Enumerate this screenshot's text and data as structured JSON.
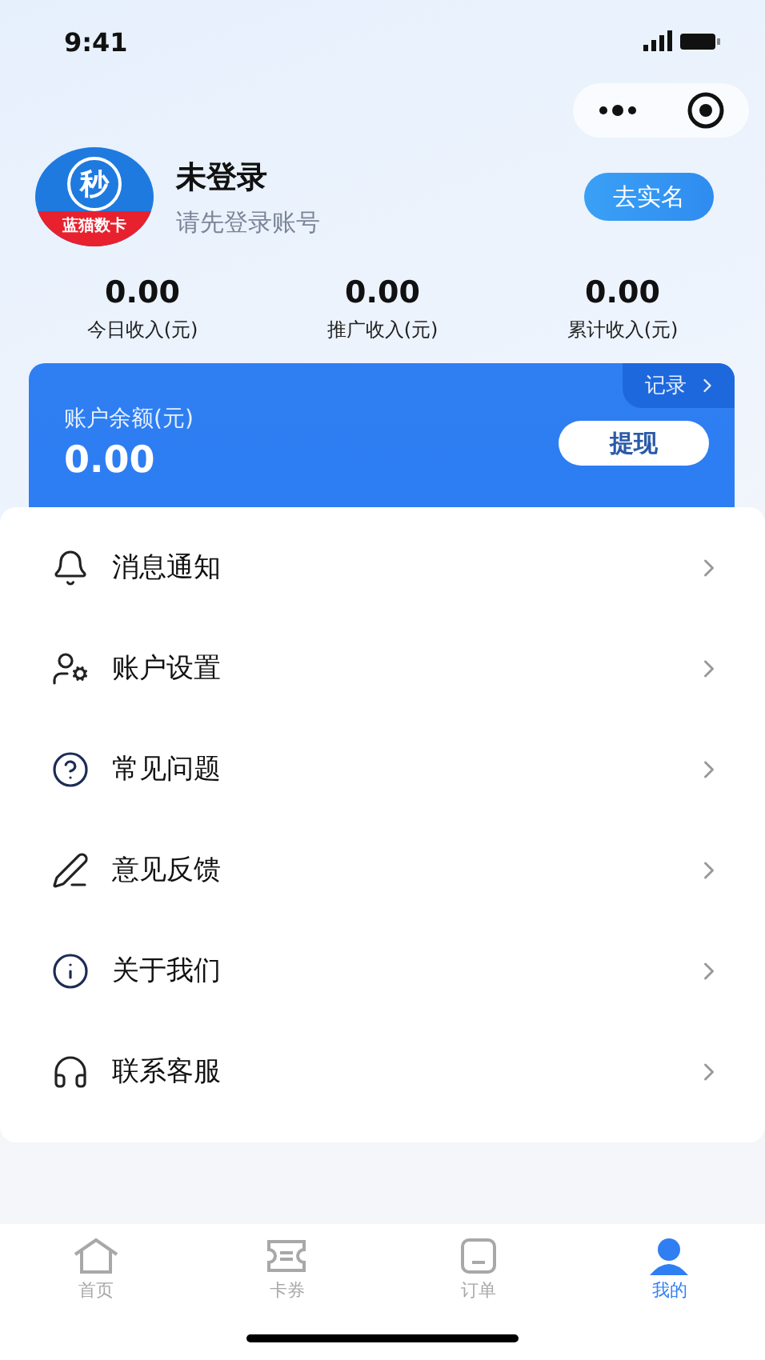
{
  "status_bar": {
    "time": "9:41"
  },
  "profile": {
    "logo_mark": "秒",
    "logo_text": "蓝猫数卡",
    "name": "未登录",
    "subtitle": "请先登录账号",
    "verify_button": "去实名"
  },
  "stats": [
    {
      "value": "0.00",
      "label": "今日收入(元)"
    },
    {
      "value": "0.00",
      "label": "推广收入(元)"
    },
    {
      "value": "0.00",
      "label": "累计收入(元)"
    }
  ],
  "balance": {
    "label": "账户余额(元)",
    "amount": "0.00",
    "records_link": "记录",
    "withdraw_button": "提现"
  },
  "menu": [
    {
      "kind": "bell",
      "label": "消息通知"
    },
    {
      "kind": "account",
      "label": "账户设置"
    },
    {
      "kind": "question",
      "label": "常见问题"
    },
    {
      "kind": "pen",
      "label": "意见反馈"
    },
    {
      "kind": "info",
      "label": "关于我们"
    },
    {
      "kind": "headset",
      "label": "联系客服"
    }
  ],
  "tabs": [
    {
      "kind": "home",
      "label": "首页",
      "selected": false
    },
    {
      "kind": "ticket",
      "label": "卡券",
      "selected": false
    },
    {
      "kind": "order",
      "label": "订单",
      "selected": false
    },
    {
      "kind": "user",
      "label": "我的",
      "selected": true
    }
  ]
}
